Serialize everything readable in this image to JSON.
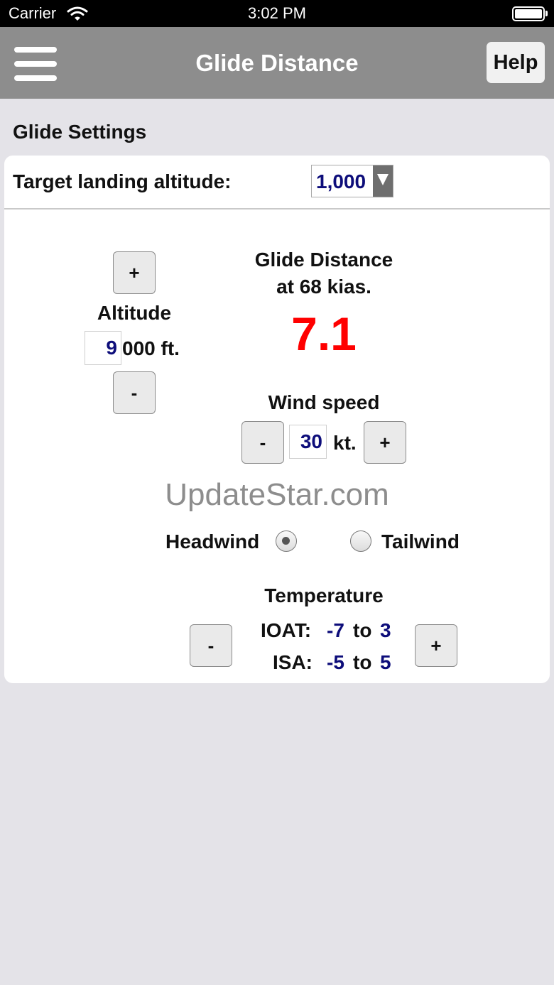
{
  "status_bar": {
    "carrier": "Carrier",
    "time": "3:02 PM"
  },
  "nav": {
    "title": "Glide Distance",
    "help_label": "Help"
  },
  "section_title": "Glide Settings",
  "target": {
    "label": "Target landing altitude:",
    "value": "1,000"
  },
  "altitude": {
    "plus_label": "+",
    "minus_label": "-",
    "label": "Altitude",
    "value": "9",
    "suffix": "000 ft."
  },
  "glide": {
    "line1": "Glide Distance",
    "line2": "at 68 kias.",
    "value": "7.1"
  },
  "wind": {
    "label": "Wind speed",
    "minus_label": "-",
    "plus_label": "+",
    "value": "30",
    "unit": "kt.",
    "headwind_label": "Headwind",
    "tailwind_label": "Tailwind",
    "selected": "Headwind"
  },
  "watermark": "UpdateStar.com",
  "temperature": {
    "label": "Temperature",
    "minus_label": "-",
    "plus_label": "+",
    "ioat_label": "IOAT:",
    "ioat_low": "-7",
    "ioat_high": "3",
    "isa_label": "ISA:",
    "isa_low": "-5",
    "isa_high": "5",
    "to_word": "to"
  }
}
